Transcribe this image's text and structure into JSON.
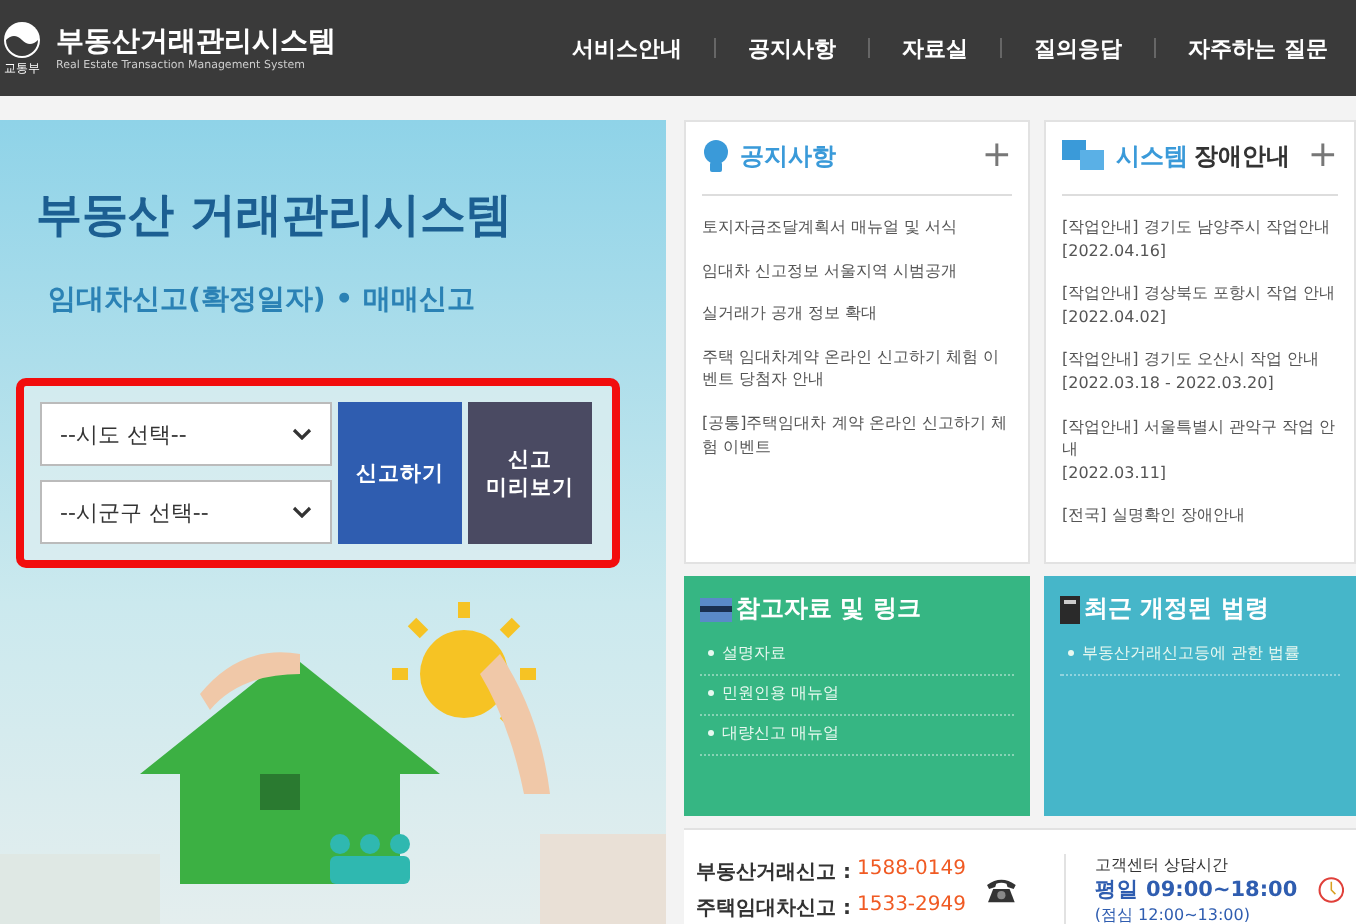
{
  "header": {
    "ministry": "교통부",
    "title": "부동산거래관리시스템",
    "subtitle": "Real Estate Transaction Management System",
    "nav": [
      {
        "label": "서비스안내"
      },
      {
        "label": "공지사항"
      },
      {
        "label": "자료실"
      },
      {
        "label": "질의응답"
      },
      {
        "label": "자주하는 질문"
      }
    ]
  },
  "hero": {
    "title": "부동산 거래관리시스템",
    "subtitle": "임대차신고(확정일자) • 매매신고",
    "selects": [
      {
        "placeholder": "--시도 선택--"
      },
      {
        "placeholder": "--시군구 선택--"
      }
    ],
    "buttons": [
      {
        "kind": "primary",
        "lines": [
          "신고하기"
        ]
      },
      {
        "kind": "secondary",
        "lines": [
          "신고",
          "미리보기"
        ]
      }
    ]
  },
  "notices": {
    "title": "공지사항",
    "more": "+",
    "items": [
      {
        "text": "토지자금조달계획서 매뉴얼 및 서식"
      },
      {
        "text": "임대차 신고정보 서울지역 시범공개"
      },
      {
        "text": "실거래가 공개 정보 확대"
      },
      {
        "text": "주택 임대차계약 온라인 신고하기 체험 이벤트 당첨자 안내"
      },
      {
        "text": "[공통]주택임대차 계약 온라인 신고하기 체험 이벤트"
      }
    ]
  },
  "outages": {
    "title_accent": "시스템",
    "title_rest": "장애안내",
    "more": "+",
    "items": [
      {
        "text": "[작업안내] 경기도 남양주시 작업안내",
        "date": "[2022.04.16]"
      },
      {
        "text": "[작업안내] 경상북도 포항시 작업 안내",
        "date": "[2022.04.02]"
      },
      {
        "text": "[작업안내] 경기도 오산시 작업 안내",
        "date": "[2022.03.18 - 2022.03.20]"
      },
      {
        "text": "[작업안내] 서울특별시 관악구 작업 안내",
        "date": "[2022.03.11]"
      },
      {
        "text": "[전국] 실명확인 장애안내"
      }
    ]
  },
  "references": {
    "title": "참고자료 및 링크",
    "items": [
      {
        "text": "설명자료"
      },
      {
        "text": "민원인용 매뉴얼"
      },
      {
        "text": "대량신고 매뉴얼"
      }
    ]
  },
  "laws": {
    "title": "최근 개정된 법령",
    "items": [
      {
        "text": "부동산거래신고등에 관한 법률"
      }
    ]
  },
  "contact": {
    "lines": [
      {
        "label": "부동산거래신고 :",
        "number": "1588-0149"
      },
      {
        "label": "주택임대차신고 :",
        "number": "1533-2949"
      }
    ],
    "hours_title": "고객센터 상담시간",
    "hours": "평일 09:00~18:00",
    "lunch": "(점심 12:00~13:00)"
  }
}
